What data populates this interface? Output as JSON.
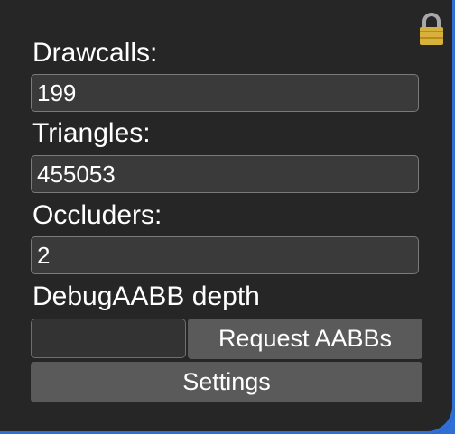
{
  "panel": {
    "lock_icon": "lock-icon"
  },
  "stats": {
    "drawcalls_label": "Drawcalls:",
    "drawcalls_value": "199",
    "triangles_label": "Triangles:",
    "triangles_value": "455053",
    "occluders_label": "Occluders:",
    "occluders_value": "2"
  },
  "debug": {
    "aabb_depth_label": "DebugAABB depth",
    "aabb_depth_value": "",
    "request_button_label": "Request AABBs",
    "settings_button_label": "Settings"
  },
  "colors": {
    "panel_bg": "#262626",
    "field_bg": "#3a3a3a",
    "button_bg": "#5a5a5a",
    "accent_edge": "#2f6fd6",
    "lock_gold": "#d8b13b"
  }
}
